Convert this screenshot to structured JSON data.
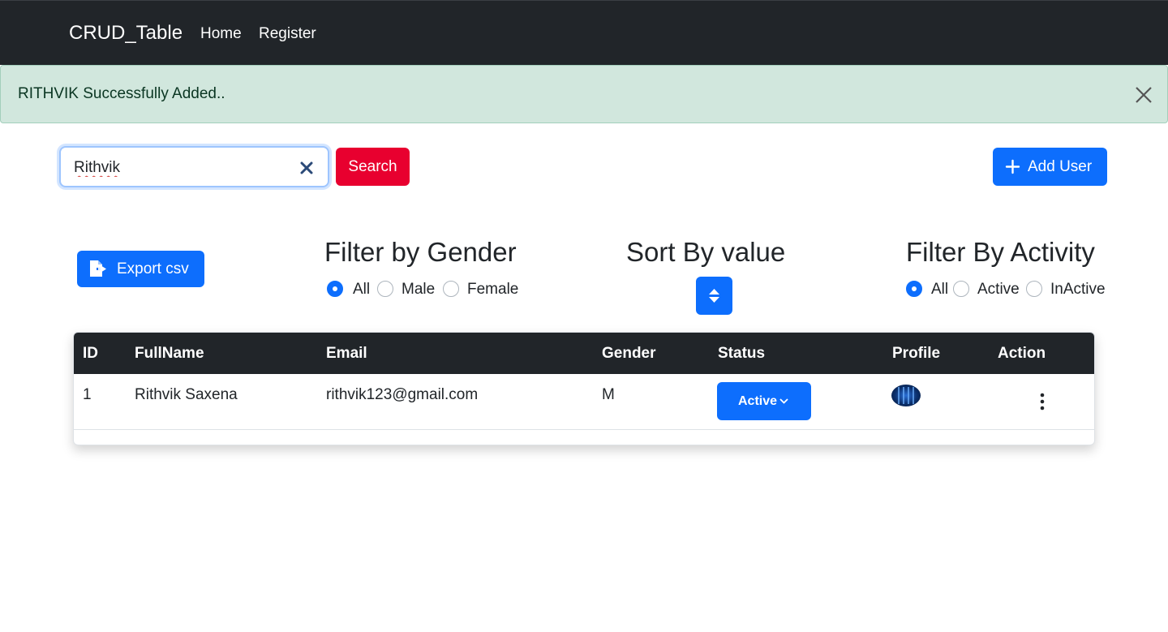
{
  "navbar": {
    "brand": "CRUD_Table",
    "links": [
      "Home",
      "Register"
    ]
  },
  "alert": {
    "message": "RITHVIK Successfully Added.."
  },
  "search": {
    "value": "Rithvik",
    "button_label": "Search"
  },
  "add_user_label": "Add User",
  "export_label": "Export csv",
  "filters": {
    "gender": {
      "title": "Filter by Gender",
      "options": [
        "All",
        "Male",
        "Female"
      ],
      "selected": "All"
    },
    "sort": {
      "title": "Sort By value"
    },
    "activity": {
      "title": "Filter By Activity",
      "options": [
        "All",
        "Active",
        "InActive"
      ],
      "selected": "All"
    }
  },
  "table": {
    "headers": [
      "ID",
      "FullName",
      "Email",
      "Gender",
      "Status",
      "Profile",
      "Action"
    ],
    "rows": [
      {
        "id": "1",
        "fullname": "Rithvik Saxena",
        "email": "rithvik123@gmail.com",
        "gender": "M",
        "status": "Active"
      }
    ]
  },
  "colors": {
    "navbar_bg": "#212529",
    "alert_bg": "#d1e7dd",
    "primary": "#0d6efd",
    "search_button": "#e8002f"
  }
}
